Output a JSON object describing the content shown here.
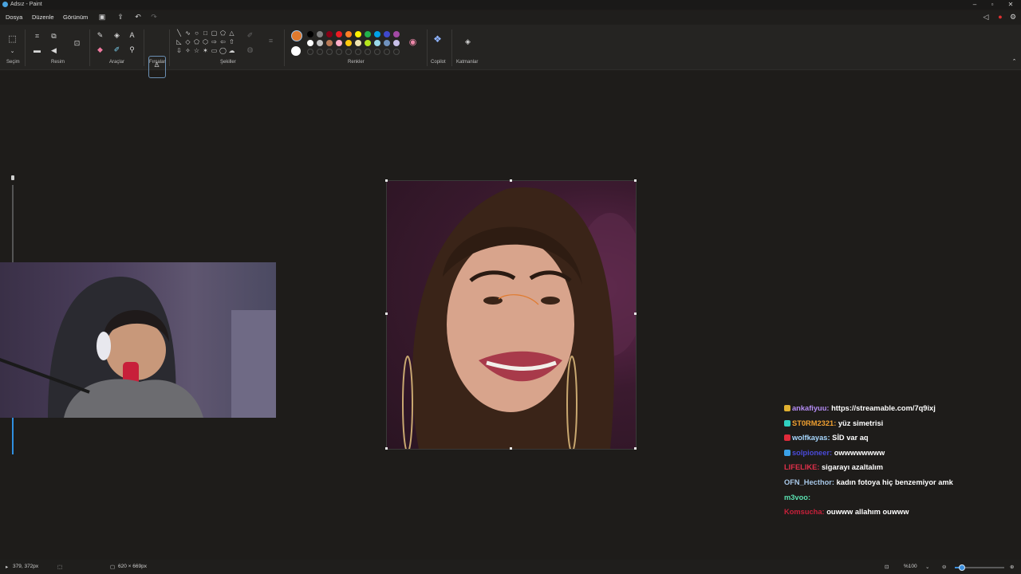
{
  "window": {
    "title": "Adsız - Paint"
  },
  "menu": {
    "file": "Dosya",
    "edit": "Düzenle",
    "view": "Görünüm"
  },
  "ribbon": {
    "groups": {
      "selection": "Seçim",
      "image": "Resim",
      "tools": "Araçlar",
      "brushes": "Fırçalar",
      "shapes": "Şekiller",
      "colors": "Renkler",
      "copilot": "Copilot",
      "layers": "Katmanlar"
    },
    "color1": "#e07a2e",
    "color2": "#ffffff",
    "palette_row1": [
      "#000000",
      "#7f7f7f",
      "#880015",
      "#ed1c24",
      "#ff7f27",
      "#fff200",
      "#22b14c",
      "#00a2e8",
      "#3f48cc",
      "#a349a4"
    ],
    "palette_row2": [
      "#ffffff",
      "#c3c3c3",
      "#b97a57",
      "#ffaec9",
      "#ffc90e",
      "#efe4b0",
      "#b5e61d",
      "#99d9ea",
      "#7092be",
      "#c8bfe7"
    ]
  },
  "status": {
    "cursor_pos": "379, 372px",
    "canvas_size": "620 × 669px",
    "zoom": "%100",
    "zoom_level": 0.13
  },
  "chat": [
    {
      "user": "ankafiyuu:",
      "user_color": "#b58cf5",
      "badge_color": "#e0b030",
      "message": "https://streamable.com/7q9ixj"
    },
    {
      "user": "ST0RM2321:",
      "user_color": "#f0a030",
      "badge_color": "#30d0c0",
      "message": "yüz simetrisi"
    },
    {
      "user": "wolfkayas:",
      "user_color": "#a8d8ff",
      "badge_color": "#e02a3a",
      "message": "SİD var aq"
    },
    {
      "user": "solpioneer:",
      "user_color": "#4a4ad8",
      "badge_color": "#3aa0e8",
      "message": "owwwwwwww"
    },
    {
      "user": "LIFELIKE:",
      "user_color": "#e0304a",
      "badge_color": "",
      "message": "sigarayı azaltalım"
    },
    {
      "user": "OFN_Hecthor:",
      "user_color": "#a8c8e8",
      "badge_color": "",
      "message": "kadın fotoya hiç benzemiyor amk"
    },
    {
      "user": "m3voo:",
      "user_color": "#5ae0b0",
      "badge_color": "",
      "message": ""
    },
    {
      "user": "Komsucha:",
      "user_color": "#c8203a",
      "badge_color": "",
      "message": "ouwww allahım ouwww"
    }
  ]
}
